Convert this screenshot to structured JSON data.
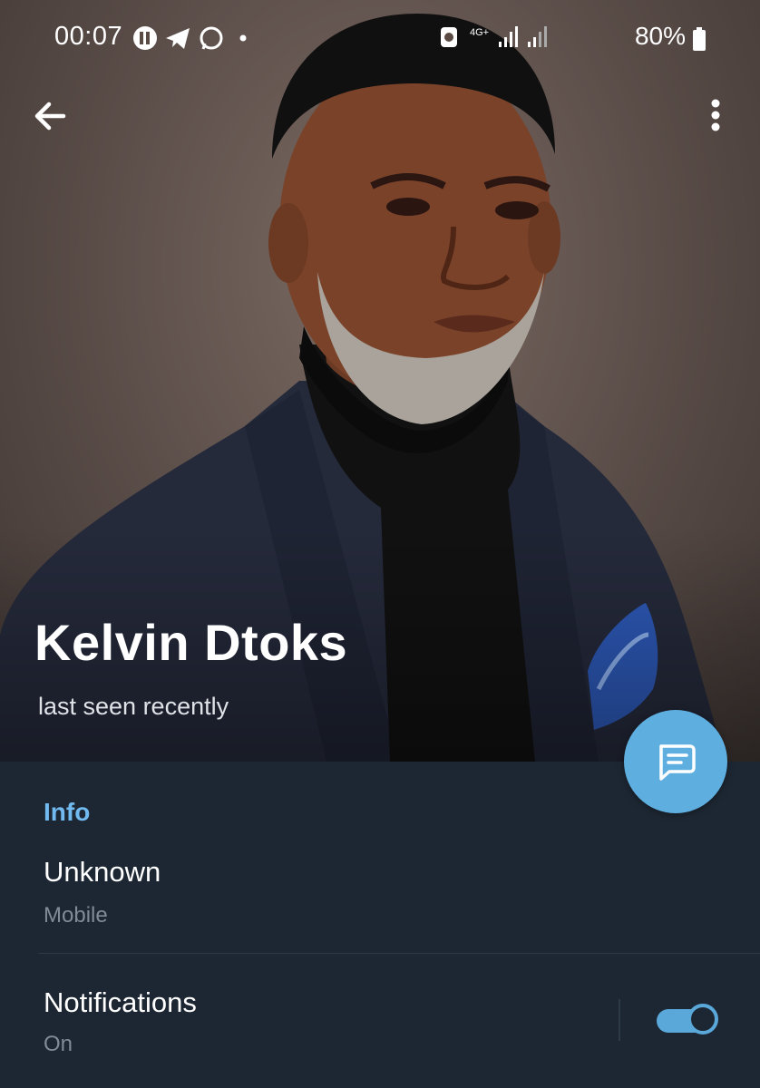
{
  "status_bar": {
    "time": "00:07",
    "network": "4G+",
    "battery": "80%"
  },
  "profile": {
    "name": "Kelvin Dtoks",
    "status": "last seen recently"
  },
  "info": {
    "header": "Info",
    "phone_value": "Unknown",
    "phone_label": "Mobile",
    "notifications_label": "Notifications",
    "notifications_value": "On",
    "notifications_enabled": true
  },
  "colors": {
    "panel_bg": "#1d2733",
    "accent": "#5eaee0",
    "header_accent": "#71baf0"
  },
  "icons": {
    "back": "arrow-left-icon",
    "more": "more-vertical-icon",
    "fab": "message-icon"
  }
}
